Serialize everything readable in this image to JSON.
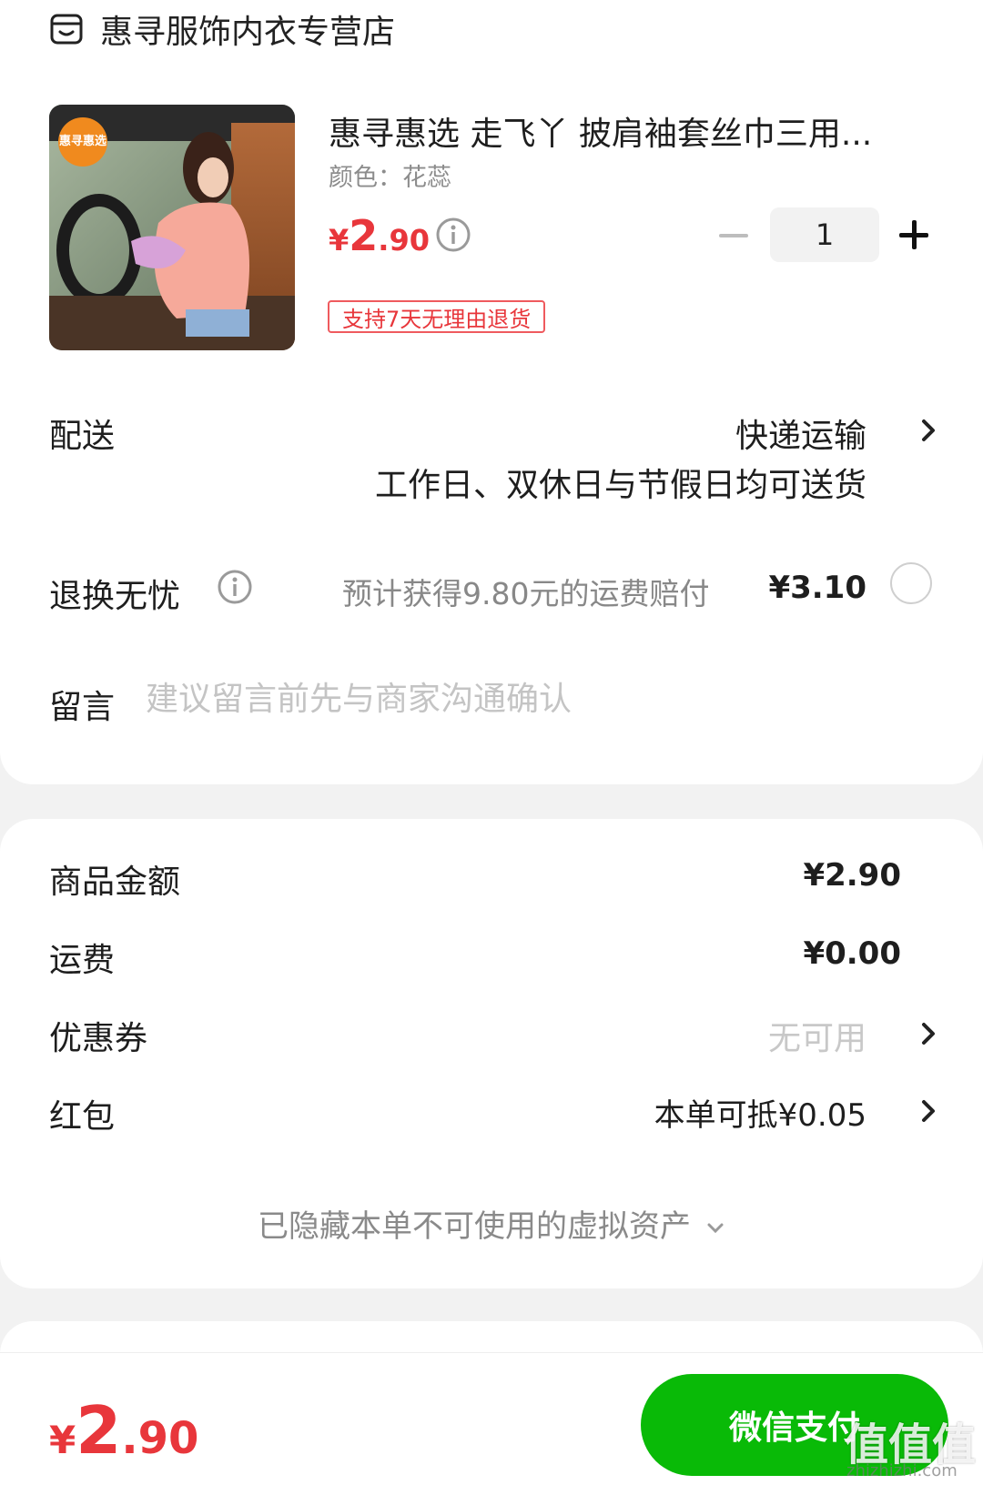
{
  "store": {
    "name": "惠寻服饰内衣专营店"
  },
  "product": {
    "badge_text": "惠寻惠选",
    "title": "惠寻惠选 走飞丫 披肩袖套丝巾三用...",
    "variant": "颜色：花蕊",
    "price_symbol": "¥",
    "price_int": "2",
    "price_dec": ".90",
    "quantity": "1",
    "return_policy": "支持7天无理由退货"
  },
  "shipping": {
    "label": "配送",
    "method": "快递运输",
    "note": "工作日、双休日与节假日均可送货"
  },
  "return_insurance": {
    "label": "退换无忧",
    "description": "预计获得9.80元的运费赔付",
    "price": "¥3.10"
  },
  "message": {
    "label": "留言",
    "placeholder": "建议留言前先与商家沟通确认"
  },
  "summary": {
    "goods_label": "商品金额",
    "goods_value": "¥2.90",
    "freight_label": "运费",
    "freight_value": "¥0.00",
    "coupon_label": "优惠券",
    "coupon_value": "无可用",
    "redpacket_label": "红包",
    "redpacket_value": "本单可抵¥0.05",
    "hidden_assets": "已隐藏本单不可使用的虚拟资产"
  },
  "checkout": {
    "total_symbol": "¥",
    "total_int": "2",
    "total_dec": ".90",
    "pay_label": "微信支付"
  },
  "watermark": {
    "text": "值值值",
    "sub": "zhizhizhi.com"
  },
  "colors": {
    "price_red": "#e8363b",
    "pay_green": "#09ba07",
    "page_bg": "#f2f2f2"
  }
}
